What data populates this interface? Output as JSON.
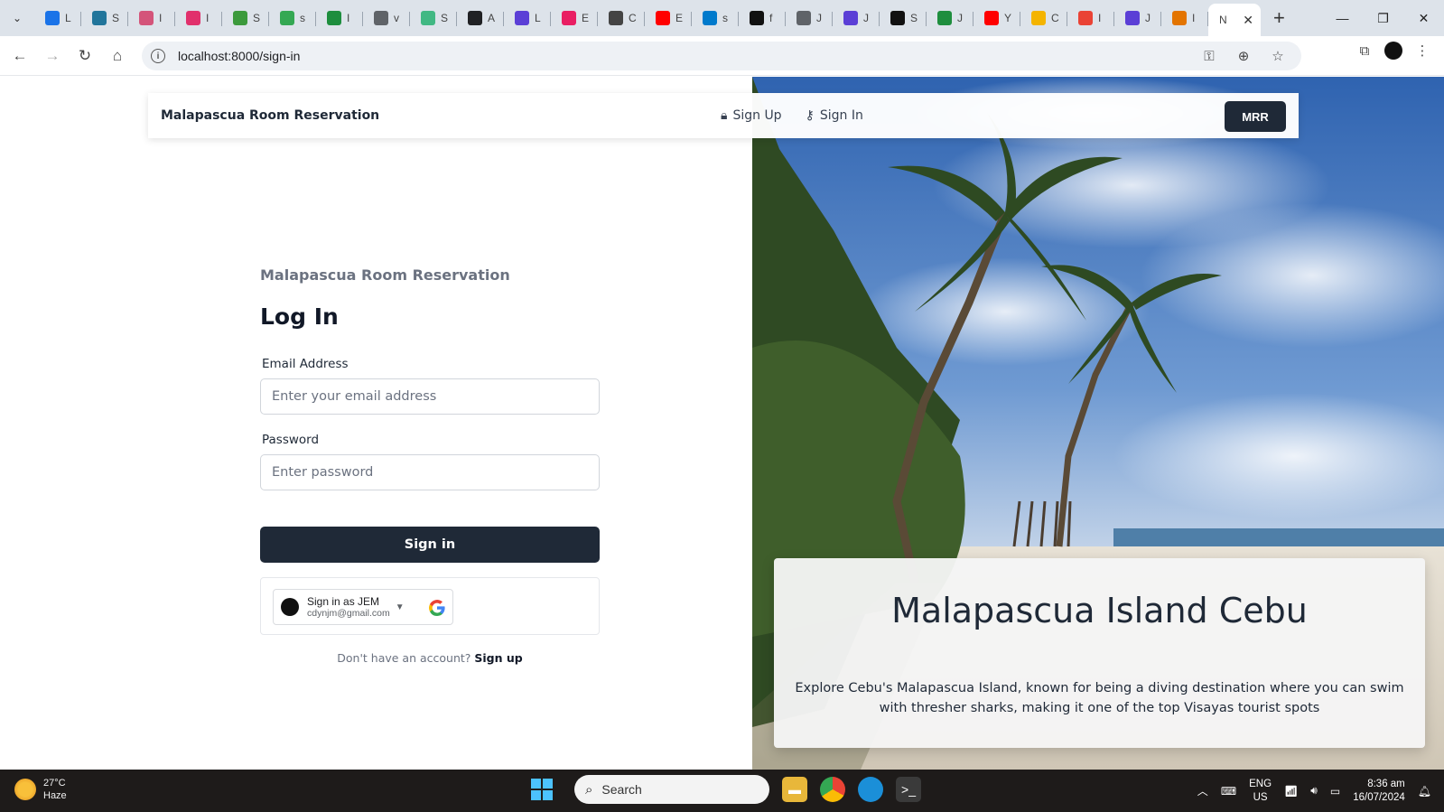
{
  "browser": {
    "tabs": [
      {
        "icon": "flag-icon",
        "color": "#1a73e8",
        "letter": "L"
      },
      {
        "icon": "wordpress-icon",
        "color": "#21759b",
        "letter": "S"
      },
      {
        "icon": "book-icon",
        "color": "#d4547a",
        "letter": "I"
      },
      {
        "icon": "camera-icon",
        "color": "#e1306c",
        "letter": "I"
      },
      {
        "icon": "leaf-icon",
        "color": "#3c9a3c",
        "letter": "S"
      },
      {
        "icon": "map-pin-icon",
        "color": "#34a853",
        "letter": "s"
      },
      {
        "icon": "chart-icon",
        "color": "#1e8e3e",
        "letter": "I"
      },
      {
        "icon": "globe-icon",
        "color": "#5f6368",
        "letter": "v"
      },
      {
        "icon": "vue-icon",
        "color": "#41b883",
        "letter": "S"
      },
      {
        "icon": "square-icon",
        "color": "#202124",
        "letter": "A"
      },
      {
        "icon": "hook-icon",
        "color": "#5b3fd6",
        "letter": "L"
      },
      {
        "icon": "cube-icon",
        "color": "#e91e63",
        "letter": "E"
      },
      {
        "icon": "openai-icon",
        "color": "#444444",
        "letter": "C"
      },
      {
        "icon": "youtube-icon",
        "color": "#ff0000",
        "letter": "E"
      },
      {
        "icon": "vscode-icon",
        "color": "#007acc",
        "letter": "s"
      },
      {
        "icon": "tiktok-icon",
        "color": "#111111",
        "letter": "f"
      },
      {
        "icon": "globe-icon",
        "color": "#5f6368",
        "letter": "J"
      },
      {
        "icon": "stripes-icon",
        "color": "#5b3fd6",
        "letter": "J"
      },
      {
        "icon": "threads-icon",
        "color": "#111111",
        "letter": "S"
      },
      {
        "icon": "circle-icon",
        "color": "#1e8e3e",
        "letter": "J"
      },
      {
        "icon": "youtube-icon",
        "color": "#ff0000",
        "letter": "Y"
      },
      {
        "icon": "bulb-icon",
        "color": "#f4b400",
        "letter": "C"
      },
      {
        "icon": "gmail-icon",
        "color": "#ea4335",
        "letter": "I"
      },
      {
        "icon": "stripes-icon",
        "color": "#5b3fd6",
        "letter": "J"
      },
      {
        "icon": "mountain-icon",
        "color": "#e37400",
        "letter": "I"
      }
    ],
    "active_tab": {
      "letter": "N",
      "close": "✕"
    },
    "url": "localhost:8000/sign-in"
  },
  "nav": {
    "brand": "Malapascua Room Reservation",
    "signup": "Sign Up",
    "signin": "Sign In",
    "badge": "MRR"
  },
  "form": {
    "subtitle": "Malapascua Room Reservation",
    "title": "Log In",
    "email_label": "Email Address",
    "email_placeholder": "Enter your email address",
    "password_label": "Password",
    "password_placeholder": "Enter password",
    "submit": "Sign in",
    "google_name": "Sign in as JEM",
    "google_email": "cdynjm@gmail.com",
    "no_account": "Don't have an account?",
    "signup_link": "Sign up"
  },
  "hero_card": {
    "title": "Malapascua Island Cebu",
    "text": "Explore Cebu's Malapascua Island, known for being a diving destination where you can swim with thresher sharks, making it one of the top Visayas tourist spots"
  },
  "taskbar": {
    "temp": "27°C",
    "condition": "Haze",
    "search": "Search",
    "lang": "ENG",
    "region": "US",
    "time": "8:36 am",
    "date": "16/07/2024"
  }
}
